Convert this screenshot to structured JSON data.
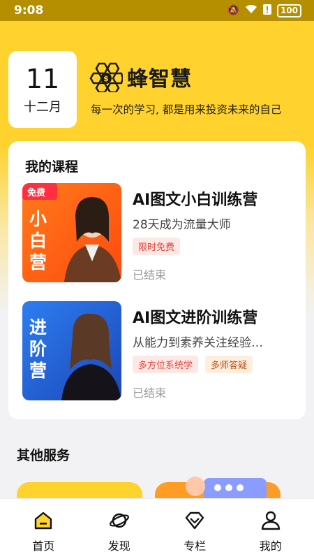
{
  "status_bar": {
    "time": "9:08",
    "battery": "100"
  },
  "header": {
    "date_day": "11",
    "date_month": "十二月",
    "brand_name": "蜂智慧",
    "slogan": "每一次的学习, 都是用来投资未来的自己",
    "accent_color": "#ffd22e"
  },
  "my_courses": {
    "title": "我的课程",
    "items": [
      {
        "title": "AI图文小白训练营",
        "subtitle": "28天成为流量大师",
        "tags": [
          "限时免费"
        ],
        "status": "已结束",
        "thumb_badge": "免费",
        "thumb_text": [
          "小",
          "白",
          "营"
        ]
      },
      {
        "title": "AI图文进阶训练营",
        "subtitle": "从能力到素养关注经验…",
        "tags": [
          "多方位系统学",
          "多师答疑"
        ],
        "status": "已结束",
        "thumb_text": [
          "进",
          "阶",
          "营"
        ]
      }
    ]
  },
  "other_services": {
    "title": "其他服务"
  },
  "tabbar": {
    "items": [
      {
        "label": "首页",
        "icon": "home-icon"
      },
      {
        "label": "发现",
        "icon": "planet-icon"
      },
      {
        "label": "专栏",
        "icon": "diamond-icon"
      },
      {
        "label": "我的",
        "icon": "user-icon"
      }
    ]
  }
}
